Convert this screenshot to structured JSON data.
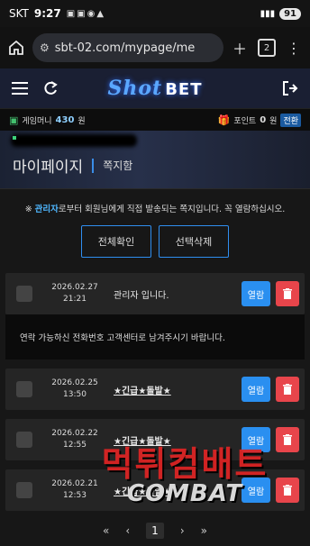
{
  "status": {
    "carrier": "SKT",
    "time": "9:27",
    "battery": "91"
  },
  "browser": {
    "url": "sbt-02.com/mypage/me",
    "tab_count": "2"
  },
  "site": {
    "logo_main": "Shot",
    "logo_accent": "BET"
  },
  "money": {
    "game_money_label": "게임머니",
    "game_money_value": "430",
    "won1": "원",
    "point_label": "포인트",
    "point_value": "0",
    "won2": "원",
    "switch_label": "전환"
  },
  "banner": {
    "title": "마이페이지",
    "subtitle": "쪽지함"
  },
  "notice": {
    "prefix": "※ ",
    "admin": "관리자",
    "text": "로부터 회원님에게 직접 발송되는 쪽지입니다. 꼭 열람하십시오."
  },
  "actions": {
    "check_all": "전체확인",
    "delete_selected": "선택삭제"
  },
  "messages": [
    {
      "date": "2026.02.27",
      "time": "21:21",
      "subject": "관리자 입니다.",
      "open_label": "열람"
    },
    {
      "date": "2026.02.25",
      "time": "13:50",
      "subject": "★긴급★돌발★",
      "open_label": "열람"
    },
    {
      "date": "2026.02.22",
      "time": "12:55",
      "subject": "★긴급★돌발★",
      "open_label": "열람"
    },
    {
      "date": "2026.02.21",
      "time": "12:53",
      "subject": "★긴급★돌발★",
      "open_label": "열람"
    }
  ],
  "open_message": {
    "body": "연락 가능하신 전화번호 고객센터로 남겨주시기 바랍니다."
  },
  "pager": {
    "first": "«",
    "prev": "‹",
    "current": "1",
    "next": "›",
    "last": "»"
  },
  "watermark": {
    "korean": "먹튀컴배트",
    "english": "COMBAT"
  },
  "colors": {
    "accent": "#2a8ff0",
    "danger": "#e8454b",
    "admin": "#4fb7ff"
  }
}
